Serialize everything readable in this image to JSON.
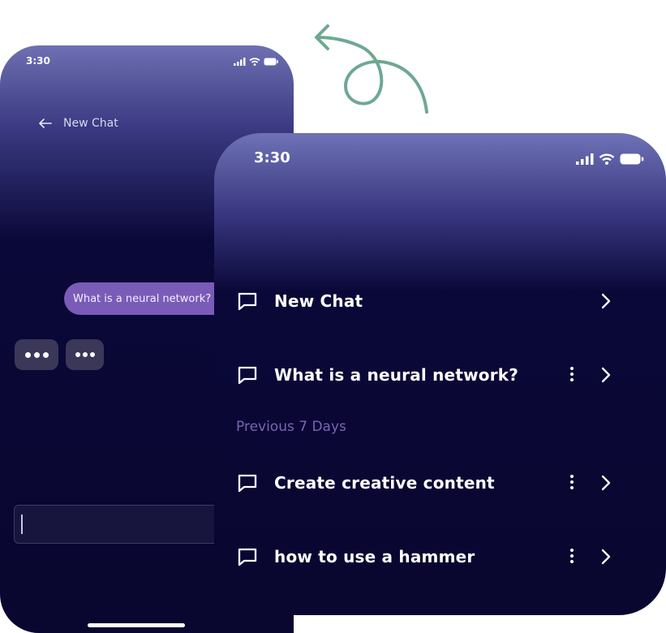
{
  "back_phone": {
    "status_time": "3:30",
    "header_title": "New Chat",
    "user_message": "What is a neural network?"
  },
  "front_phone": {
    "status_time": "3:30",
    "items": [
      {
        "label": "New Chat"
      },
      {
        "label": "What is a neural network?"
      },
      {
        "label": "Create creative content"
      },
      {
        "label": "how to use a hammer"
      }
    ],
    "section_label": "Previous 7 Days"
  },
  "colors": {
    "accent": "#7a5bb8",
    "background_dark": "#09062f",
    "gradient_top": "#6f72b6",
    "arrow": "#6fa891"
  }
}
